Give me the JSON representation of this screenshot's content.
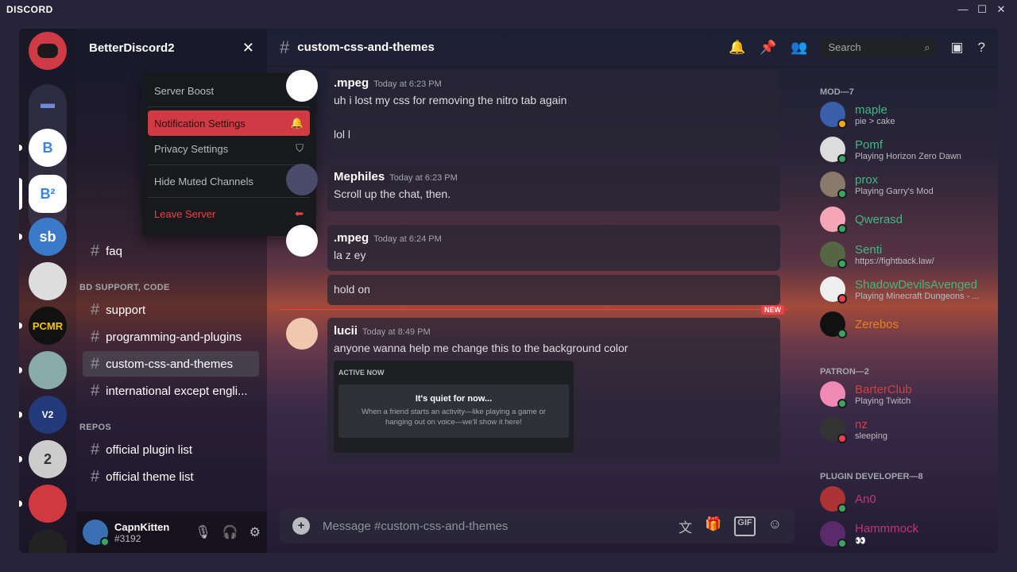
{
  "window": {
    "brand": "DISCORD",
    "controls": [
      "—",
      "☐",
      "✕"
    ]
  },
  "guild": {
    "name": "BetterDiscord2"
  },
  "menu": {
    "items": [
      {
        "label": "Server Boost",
        "icon": "boost-icon"
      },
      {
        "label": "Notification Settings",
        "icon": "bell-icon"
      },
      {
        "label": "Privacy Settings",
        "icon": "shield-icon"
      },
      {
        "label": "Hide Muted Channels",
        "icon": "checkbox-icon"
      },
      {
        "label": "Leave Server",
        "icon": "leave-icon"
      }
    ]
  },
  "channels": {
    "faq": "faq",
    "cat_support": "BD SUPPORT, CODE",
    "support": "support",
    "programming": "programming-and-plugins",
    "css": "custom-css-and-themes",
    "intl": "international except engli...",
    "cat_repos": "REPOS",
    "plugin_list": "official plugin list",
    "theme_list": "official theme list"
  },
  "user": {
    "name": "CapnKitten",
    "tag": "#3192"
  },
  "chat": {
    "channel": "custom-css-and-themes",
    "search_placeholder": "Search",
    "input_placeholder": "Message #custom-css-and-themes",
    "new_label": "NEW",
    "messages": [
      {
        "author": ".mpeg",
        "time": "Today at 6:23 PM",
        "lines": [
          "uh i  lost my css for removing the nitro tab again",
          "lol l"
        ]
      },
      {
        "author": "Mephiles",
        "time": "Today at 6:23 PM",
        "lines": [
          "Scroll up the chat, then."
        ]
      },
      {
        "author": ".mpeg",
        "time": "Today at 6:24 PM",
        "lines": [
          "la z ey",
          "hold on"
        ]
      },
      {
        "author": "lucii",
        "time": "Today at 8:49 PM",
        "lines": [
          "anyone wanna help me change this to the background color"
        ]
      }
    ],
    "embed": {
      "header": "ACTIVE NOW",
      "title": "It's quiet for now...",
      "desc": "When a friend starts an activity—like playing a game or hanging out on voice—we'll show it here!"
    }
  },
  "members": {
    "groups": [
      {
        "title": "MOD—7",
        "list": [
          {
            "name": "maple",
            "status": "pie > cake",
            "color": "#43b581",
            "presence": "idle"
          },
          {
            "name": "Pomf",
            "status": "Playing Horizon Zero Dawn",
            "color": "#43b581",
            "presence": "online"
          },
          {
            "name": "prox",
            "status": "Playing Garry's Mod",
            "color": "#43b581",
            "presence": "online"
          },
          {
            "name": "Qwerasd",
            "status": "",
            "color": "#43b581",
            "presence": "online"
          },
          {
            "name": "Senti",
            "status": "https://fightback.law/",
            "color": "#43b581",
            "presence": "online"
          },
          {
            "name": "ShadowDevilsAvenged",
            "status": "Playing Minecraft Dungeons - ...",
            "color": "#43b581",
            "presence": "dnd"
          },
          {
            "name": "Zerebos",
            "status": "",
            "color": "#e67e22",
            "presence": "online"
          }
        ]
      },
      {
        "title": "PATRON—2",
        "list": [
          {
            "name": "BarterClub",
            "status": "Playing Twitch",
            "color": "#d0403f",
            "presence": "online"
          },
          {
            "name": "nz",
            "status": "sleeping",
            "color": "#d0403f",
            "presence": "dnd"
          }
        ]
      },
      {
        "title": "PLUGIN DEVELOPER—8",
        "list": [
          {
            "name": "An0",
            "status": "",
            "color": "#c2357a",
            "presence": "online"
          },
          {
            "name": "Hammmock",
            "status": "👀",
            "color": "#c2357a",
            "presence": "online"
          }
        ]
      }
    ]
  }
}
